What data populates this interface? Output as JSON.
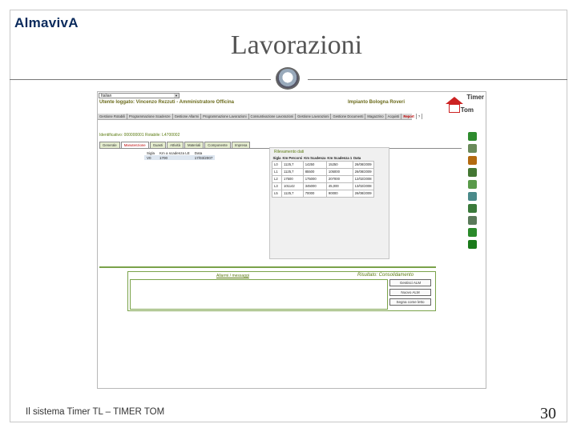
{
  "slide": {
    "logo": "AlmavivA",
    "title": "Lavorazioni",
    "footer": "Il sistema Timer TL – TIMER TOM",
    "page_number": "30"
  },
  "app": {
    "language": "Italian",
    "user_line": "Utente loggato: Vincenzo Rezzuti - Amministratore Officina",
    "plant_line": "Impianto Bologna Roveri",
    "logo_top": "Timer",
    "logo_bottom": "Tom",
    "menu": [
      {
        "label": "Gestione Rotabili",
        "active": false
      },
      {
        "label": "Programmazione Scadenze",
        "active": false
      },
      {
        "label": "Gestione Allarmi",
        "active": false
      },
      {
        "label": "Programmazione Lavorazioni",
        "active": false
      },
      {
        "label": "Consuntivazione Lavorazioni",
        "active": false
      },
      {
        "label": "Gestione Lavorazioni",
        "active": false
      },
      {
        "label": "Gestione Documenti",
        "active": false
      },
      {
        "label": "Magazzino",
        "active": false
      },
      {
        "label": "Acquisti",
        "active": false
      },
      {
        "label": "Report",
        "active": true
      },
      {
        "label": "?",
        "active": false
      }
    ],
    "identifier_line": "Identificativo: 000000001   Rotabile: L4700002",
    "tabs": [
      {
        "label": "Generale",
        "active": false
      },
      {
        "label": "Manutenzione",
        "active": true
      },
      {
        "label": "Guasti",
        "active": false
      },
      {
        "label": "Attività",
        "active": false
      },
      {
        "label": "Materiali",
        "active": false
      },
      {
        "label": "Componente",
        "active": false
      },
      {
        "label": "Impresa",
        "active": false
      }
    ],
    "small_table": {
      "headers": [
        "Sigla",
        "Km a scadenza LE",
        "Data"
      ],
      "rows": [
        [
          "V0",
          "1700",
          "17/03/2007"
        ]
      ]
    },
    "right_panel": {
      "title": "Rilevamento dati",
      "headers": [
        "Sigla",
        "Km Percorsi",
        "Km Scadenza",
        "Km Scadenza 1",
        "Data"
      ],
      "rows": [
        [
          "L0",
          "1125,7",
          "14250",
          "15250",
          "26/08/2009"
        ],
        [
          "L1",
          "1125,7",
          "85500",
          "105000",
          "26/08/2009"
        ],
        [
          "L2",
          "17500",
          "175000",
          "207000",
          "12/02/2008"
        ],
        [
          "L3",
          "101142",
          "345000",
          "45,000",
          "13/02/2008"
        ],
        [
          "L5",
          "1125,7",
          "70000",
          "90000",
          "26/08/2009"
        ]
      ]
    },
    "side_icons": [
      {
        "name": "parking-p-icon",
        "color": "#2e8b2e"
      },
      {
        "name": "list-grid-icon",
        "color": "#6a8a5a"
      },
      {
        "name": "cross-x-icon",
        "color": "#b36a10"
      },
      {
        "name": "pencil-icon",
        "color": "#447733"
      },
      {
        "name": "document-icon",
        "color": "#5a9a4a"
      },
      {
        "name": "chart-icon",
        "color": "#4a8a8a"
      },
      {
        "name": "printer-icon",
        "color": "#3a7a3a"
      },
      {
        "name": "export-icon",
        "color": "#5a7a5a"
      },
      {
        "name": "tag-icon",
        "color": "#2a8a2a"
      },
      {
        "name": "euro-icon",
        "color": "#1a7a1a"
      }
    ],
    "alerts": {
      "title": "Allarmi / messaggi",
      "status": "Risultato: Consolidamento",
      "buttons": [
        "Gestisci ALM",
        "Nuovo ALM",
        "Segna come letto"
      ]
    }
  }
}
